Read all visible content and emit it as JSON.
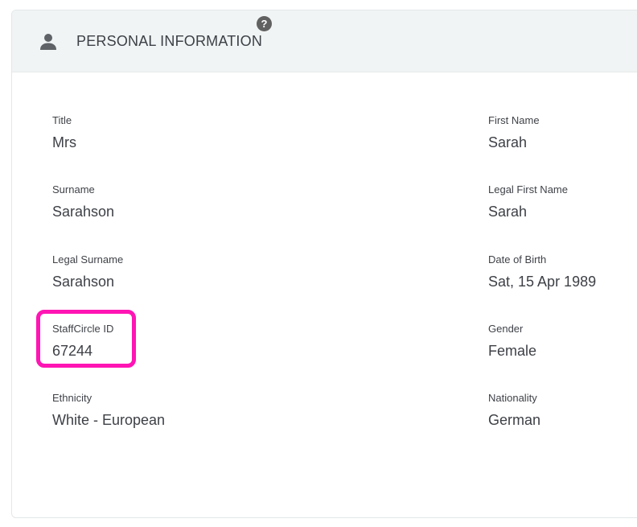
{
  "section": {
    "title": "PERSONAL INFORMATION",
    "help_icon": "?"
  },
  "left_fields": [
    {
      "label": "Title",
      "value": "Mrs"
    },
    {
      "label": "Surname",
      "value": "Sarahson"
    },
    {
      "label": "Legal Surname",
      "value": "Sarahson"
    },
    {
      "label": "StaffCircle ID",
      "value": "67244"
    },
    {
      "label": "Ethnicity",
      "value": "White - European"
    }
  ],
  "right_fields": [
    {
      "label": "First Name",
      "value": "Sarah"
    },
    {
      "label": "Legal First Name",
      "value": "Sarah"
    },
    {
      "label": "Date of Birth",
      "value": "Sat, 15 Apr 1989"
    },
    {
      "label": "Gender",
      "value": "Female"
    },
    {
      "label": "Nationality",
      "value": "German"
    }
  ],
  "colors": {
    "highlight": "#ff14b4",
    "header_bg": "#f1f4f4",
    "text": "#3d4046"
  },
  "icons": {
    "section_icon": "person-icon",
    "help": "help-icon"
  }
}
